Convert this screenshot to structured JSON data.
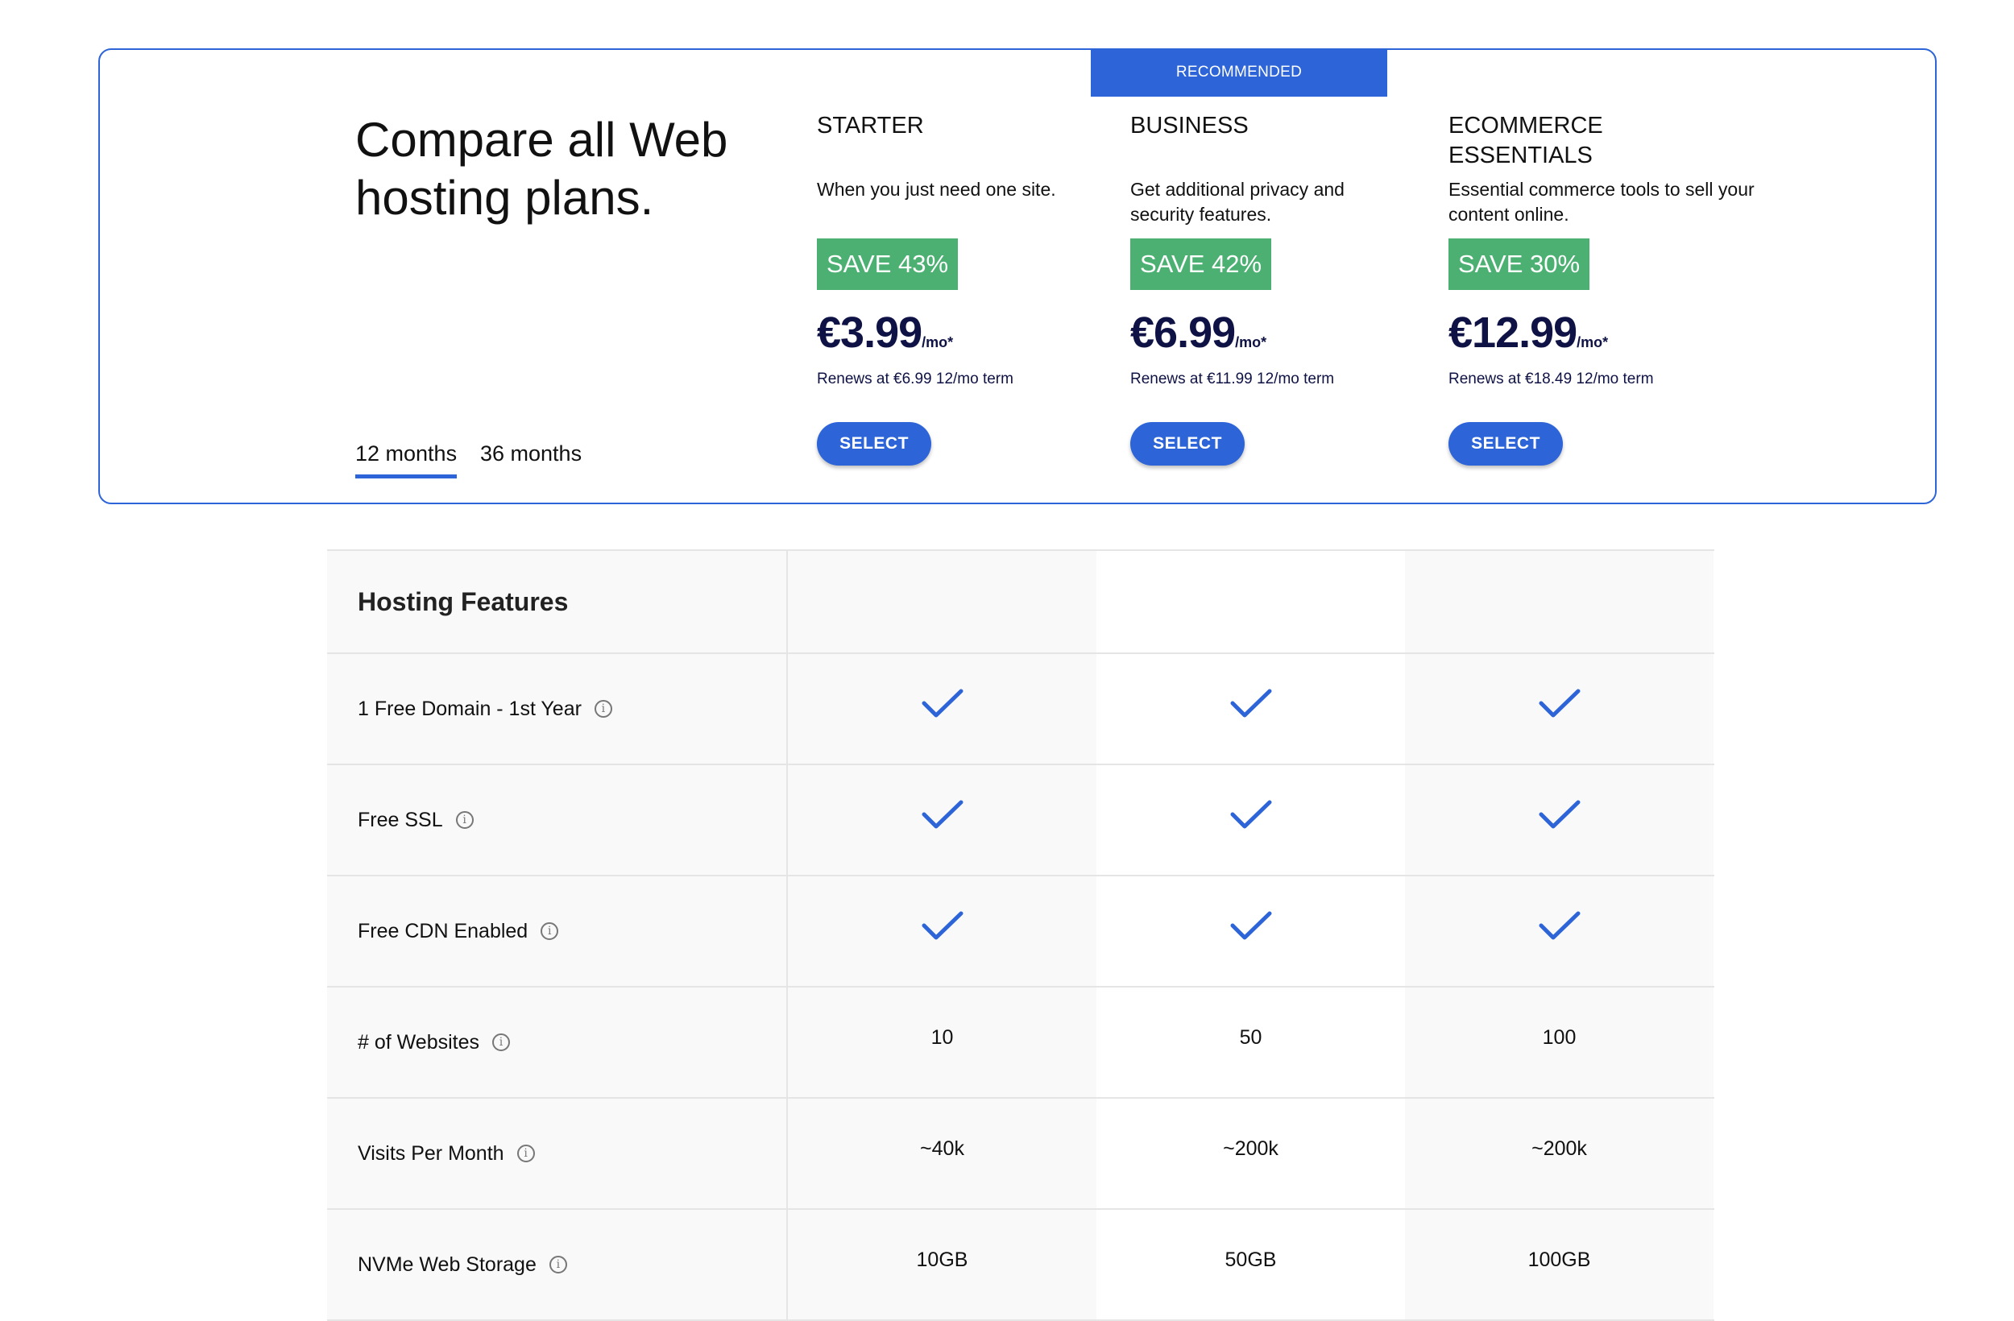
{
  "header": {
    "title": "Compare all Web hosting plans.",
    "recommended_label": "RECOMMENDED",
    "term_tabs": [
      {
        "label": "12 months",
        "active": true
      },
      {
        "label": "36 months",
        "active": false
      }
    ]
  },
  "plans": [
    {
      "name": "STARTER",
      "description": "When you just need one site.",
      "save": "SAVE 43%",
      "price": "€3.99",
      "price_unit": "/mo*",
      "renews": "Renews at €6.99 12/mo term",
      "select_label": "SELECT"
    },
    {
      "name": "BUSINESS",
      "description": "Get additional privacy and security features.",
      "save": "SAVE 42%",
      "price": "€6.99",
      "price_unit": "/mo*",
      "renews": "Renews at €11.99 12/mo term",
      "select_label": "SELECT"
    },
    {
      "name": "ECOMMERCE ESSENTIALS",
      "description": "Essential commerce tools to sell your content online.",
      "save": "SAVE 30%",
      "price": "€12.99",
      "price_unit": "/mo*",
      "renews": "Renews at €18.49 12/mo term",
      "select_label": "SELECT"
    }
  ],
  "features": {
    "heading": "Hosting Features",
    "rows": [
      {
        "label": "1 Free Domain - 1st Year",
        "values": [
          "check",
          "check",
          "check"
        ]
      },
      {
        "label": "Free SSL",
        "values": [
          "check",
          "check",
          "check"
        ]
      },
      {
        "label": "Free CDN Enabled",
        "values": [
          "check",
          "check",
          "check"
        ]
      },
      {
        "label": "# of Websites",
        "values": [
          "10",
          "50",
          "100"
        ]
      },
      {
        "label": "Visits Per Month",
        "values": [
          "~40k",
          "~200k",
          "~200k"
        ]
      },
      {
        "label": "NVMe Web Storage",
        "values": [
          "10GB",
          "50GB",
          "100GB"
        ]
      }
    ]
  },
  "colors": {
    "accent": "#2d64d8",
    "save_badge": "#4cb072",
    "price_text": "#0f1245",
    "check": "#2d64d8"
  },
  "icons": {
    "info": "info-circle-icon",
    "check": "checkmark-icon"
  }
}
